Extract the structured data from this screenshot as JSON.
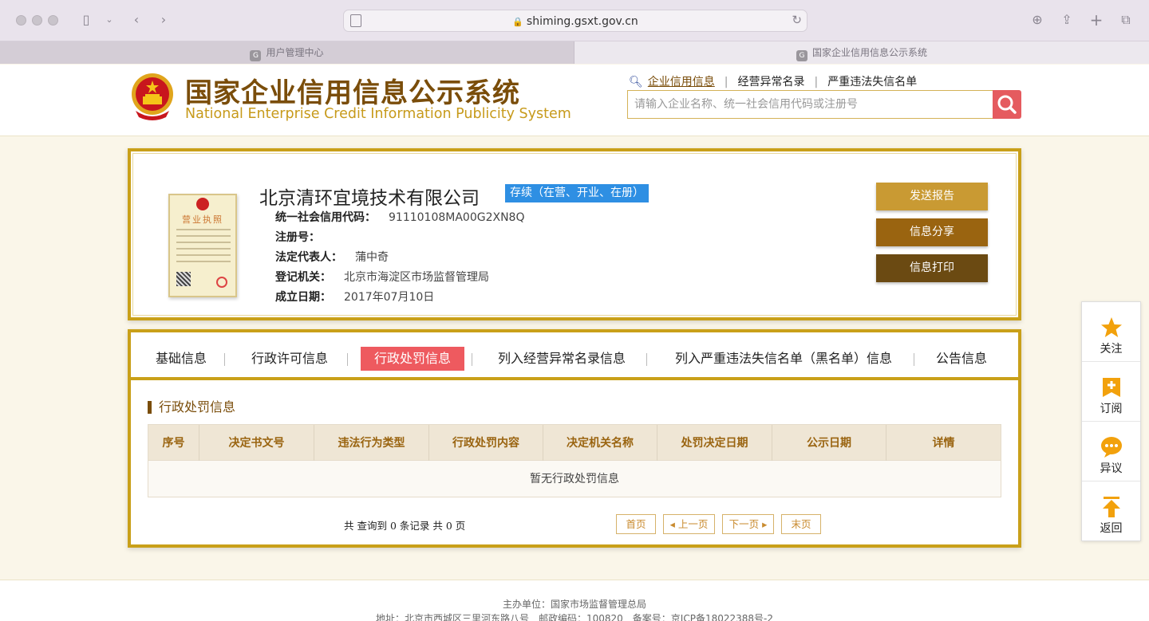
{
  "browser": {
    "url": "shiming.gsxt.gov.cn",
    "tabs": [
      {
        "label": "用户管理中心",
        "favicon": "G"
      },
      {
        "label": "国家企业信用信息公示系统",
        "favicon": "G"
      }
    ]
  },
  "header": {
    "title": "国家企业信用信息公示系统",
    "subtitle": "National Enterprise Credit Information Publicity System",
    "nav": [
      "企业信用信息",
      "经营异常名录",
      "严重违法失信名单"
    ],
    "search_placeholder": "请输入企业名称、统一社会信用代码或注册号"
  },
  "company": {
    "name": "北京清环宜境技术有限公司",
    "status": "存续（在营、开业、在册）",
    "license_title": "营业执照",
    "fields": [
      {
        "label": "统一社会信用代码：",
        "value": "91110108MA00G2XN8Q"
      },
      {
        "label": "注册号：",
        "value": ""
      },
      {
        "label": "法定代表人：",
        "value": "蒲中奇"
      },
      {
        "label": "登记机关：",
        "value": "北京市海淀区市场监督管理局"
      },
      {
        "label": "成立日期：",
        "value": "2017年07月10日"
      }
    ],
    "actions": [
      "发送报告",
      "信息分享",
      "信息打印"
    ]
  },
  "subtabs": [
    "基础信息",
    "行政许可信息",
    "行政处罚信息",
    "列入经营异常名录信息",
    "列入严重违法失信名单（黑名单）信息",
    "公告信息"
  ],
  "active_subtab": "行政处罚信息",
  "section": {
    "title": "行政处罚信息",
    "columns": [
      "序号",
      "决定书文号",
      "违法行为类型",
      "行政处罚内容",
      "决定机关名称",
      "处罚决定日期",
      "公示日期",
      "详情"
    ],
    "empty_text": "暂无行政处罚信息"
  },
  "pager": {
    "summary": "共 查询到 0 条记录 共 0 页",
    "buttons": [
      "首页",
      "上一页",
      "下一页",
      "末页"
    ]
  },
  "side": [
    "关注",
    "订阅",
    "异议",
    "返回"
  ],
  "footer": {
    "line1": "主办单位：国家市场监督管理总局",
    "line2": "地址：北京市西城区三里河东路八号　邮政编码：100820　备案号：京ICP备18022388号-2"
  },
  "colors": {
    "brand_gold": "#c9a019",
    "brand_brown": "#7a4d0a",
    "active_red": "#ee5a5f",
    "status_blue": "#2e8fe3",
    "side_icon_orange": "#f2a10c"
  }
}
